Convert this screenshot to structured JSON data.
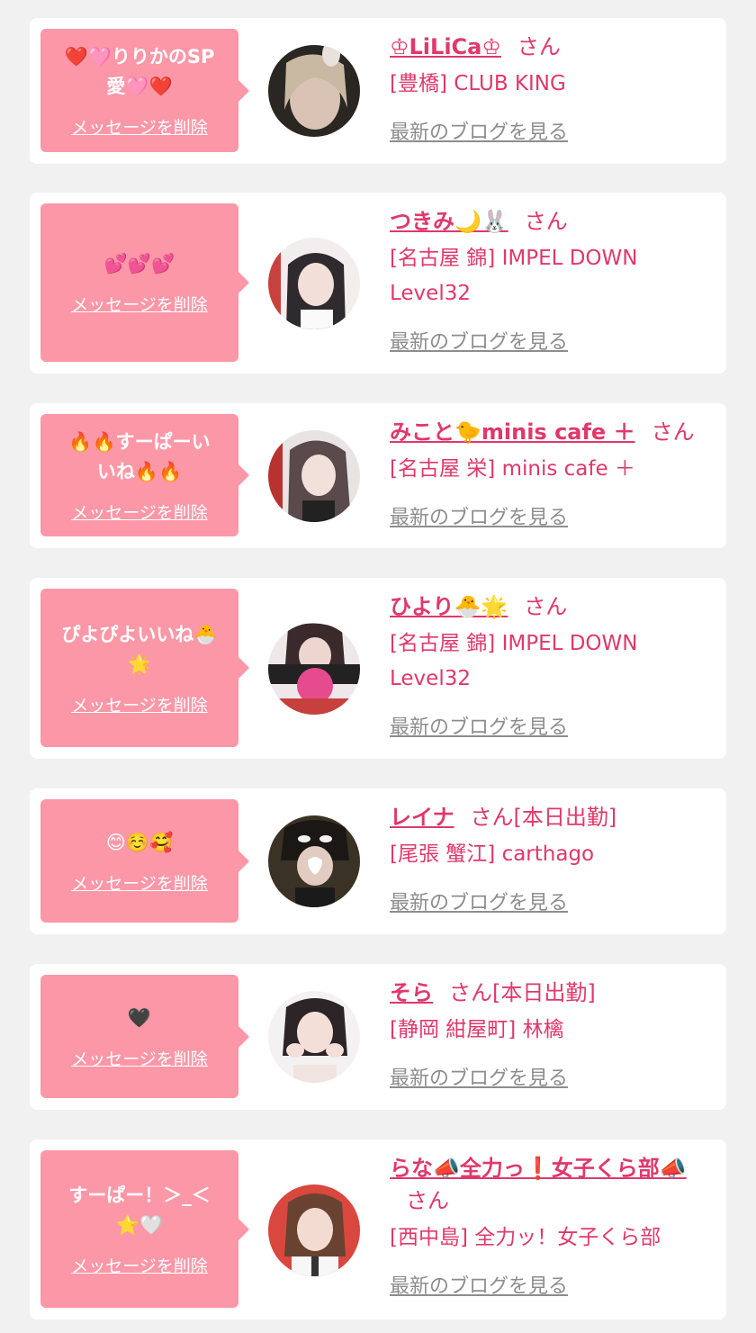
{
  "ui": {
    "delete_label": "メッセージを削除",
    "blog_label": "最新のブログを見る",
    "honorific": "さん"
  },
  "colors": {
    "background": "#f1f1f1",
    "card": "#ffffff",
    "bubble": "#fb97a7",
    "accent": "#e0386a",
    "muted_link": "#8d8d8d"
  },
  "messages": [
    {
      "message": "❤️🩷りりかのSP\n愛🩷❤️",
      "name": "♔LiLiCa♔",
      "status": "",
      "shop": "[豊橋] CLUB KING",
      "avatar_icon": "avatar-photo"
    },
    {
      "message": "💕💕💕",
      "name": "つきみ🌙🐰",
      "status": "",
      "shop": "[名古屋 錦] IMPEL DOWN Level32",
      "avatar_icon": "avatar-photo"
    },
    {
      "message": "🔥🔥すーぱーい\nいね🔥🔥",
      "name": "みこと🐤minis cafe ＋",
      "status": "",
      "shop": "[名古屋 栄] minis cafe ＋",
      "avatar_icon": "avatar-photo"
    },
    {
      "message": "ぴよぴよいいね🐣\n🌟",
      "name": "ひより🐣🌟",
      "status": "",
      "shop": "[名古屋 錦] IMPEL DOWN Level32",
      "avatar_icon": "avatar-photo"
    },
    {
      "message": "😊☺️🥰",
      "name": "レイナ",
      "status": "[本日出勤]",
      "shop": "[尾張 蟹江] carthago",
      "avatar_icon": "avatar-photo"
    },
    {
      "message": "🖤",
      "name": "そら",
      "status": "[本日出勤]",
      "shop": "[静岡 紺屋町] 林檎",
      "avatar_icon": "avatar-photo"
    },
    {
      "message": "すーぱー！＞_＜\n⭐🤍",
      "name": "らな📣全力っ❗女子くら部📣",
      "status": "",
      "shop": "[西中島] 全力ッ！女子くら部",
      "avatar_icon": "avatar-photo"
    }
  ]
}
